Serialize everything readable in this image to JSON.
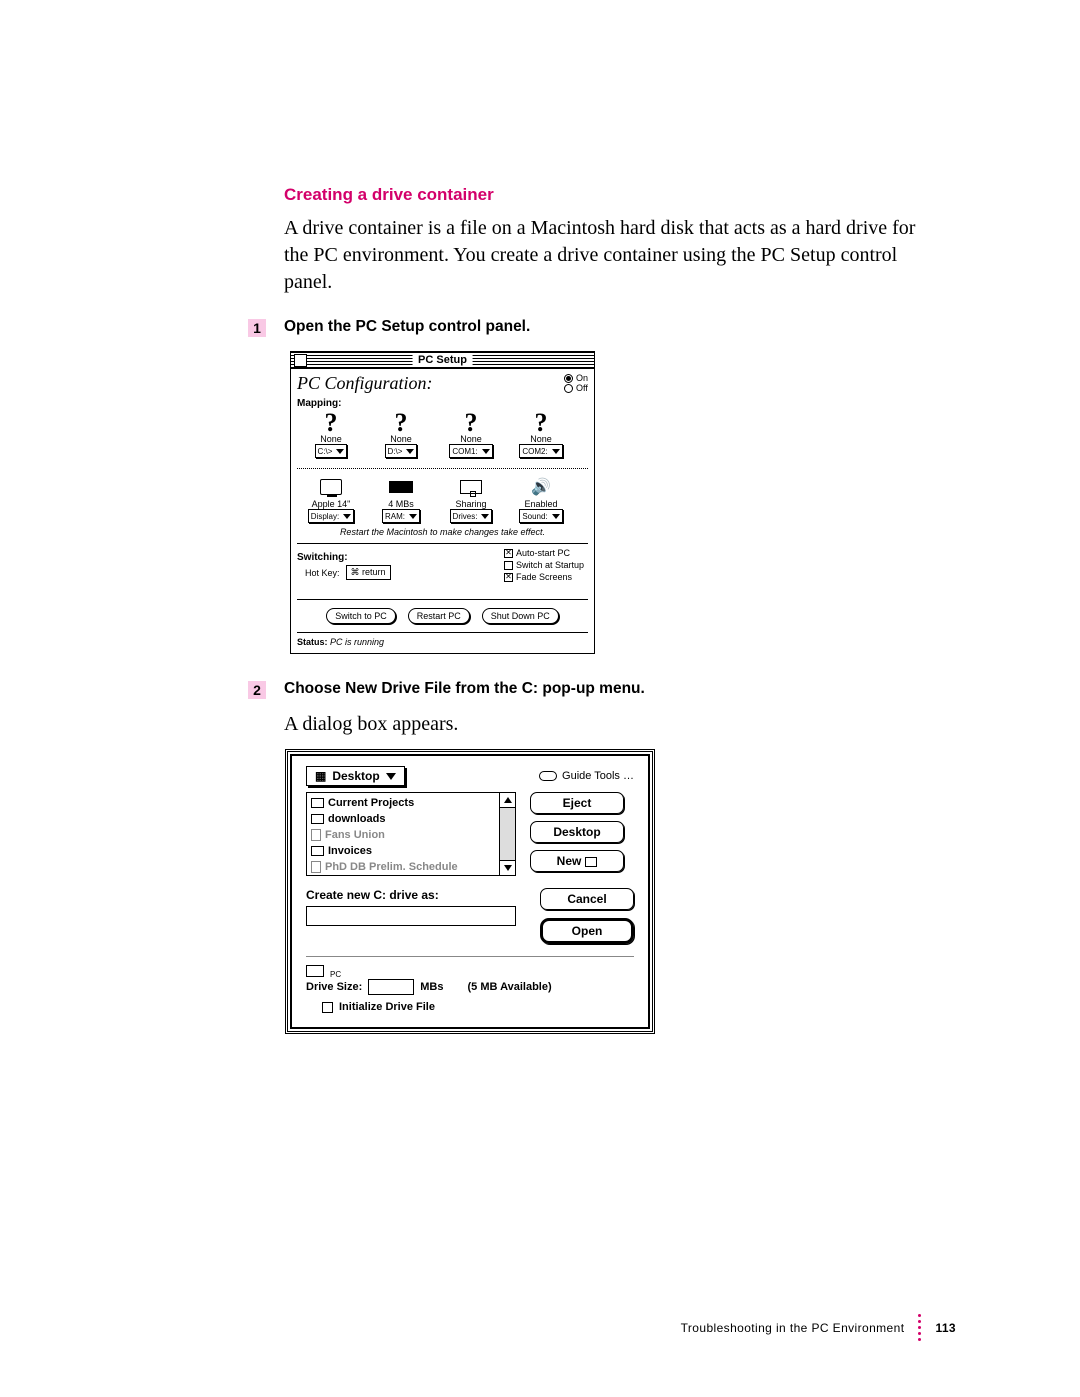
{
  "heading": "Creating a drive container",
  "intro": "A drive container is a file on a Macintosh hard disk that acts as a hard drive for the PC environment. You create a drive container using the PC Setup control panel.",
  "step1": {
    "num": "1",
    "text": "Open the PC Setup control panel."
  },
  "step2": {
    "num": "2",
    "text": "Choose New Drive File from the C: pop-up menu."
  },
  "dialog_appears": "A dialog box appears.",
  "footer": {
    "chapter": "Troubleshooting in the PC Environment",
    "page": "113"
  },
  "pcsetup": {
    "title": "PC Setup",
    "config": "PC Configuration:",
    "on": "On",
    "off": "Off",
    "mapping_label": "Mapping:",
    "slots": {
      "none": "None",
      "c": "C:\\>",
      "d": "D:\\>",
      "com1": "COM1:",
      "com2": "COM2:"
    },
    "settings": {
      "display": {
        "label": "Apple 14\"",
        "popup": "Display:"
      },
      "ram": {
        "label": "4 MBs",
        "popup": "RAM:"
      },
      "sharing": {
        "label": "Sharing",
        "popup": "Drives:"
      },
      "sound": {
        "label": "Enabled",
        "popup": "Sound:"
      }
    },
    "restart_note": "Restart the Macintosh to make changes take effect.",
    "switching_label": "Switching:",
    "hotkey_label": "Hot Key:",
    "hotkey_value": "⌘ return",
    "chk_auto": "Auto-start PC",
    "chk_startup": "Switch at Startup",
    "chk_fade": "Fade Screens",
    "btn_switch": "Switch to PC",
    "btn_restart": "Restart PC",
    "btn_shutdown": "Shut Down PC",
    "status_label": "Status:",
    "status_value": "PC is running"
  },
  "savedlg": {
    "folder": "Desktop",
    "disk": "Guide Tools …",
    "files": {
      "f1": "Current Projects",
      "f2": "downloads",
      "f3": "Fans Union",
      "f4": "Invoices",
      "f5": "PhD DB Prelim. Schedule"
    },
    "btn_eject": "Eject",
    "btn_desktop": "Desktop",
    "btn_new": "New",
    "create_label": "Create new C: drive as:",
    "btn_cancel": "Cancel",
    "btn_open": "Open",
    "drive_size_label": "Drive Size:",
    "mbs": "MBs",
    "available": "(5 MB Available)",
    "init_label": "Initialize Drive File",
    "pc_label": "PC"
  }
}
